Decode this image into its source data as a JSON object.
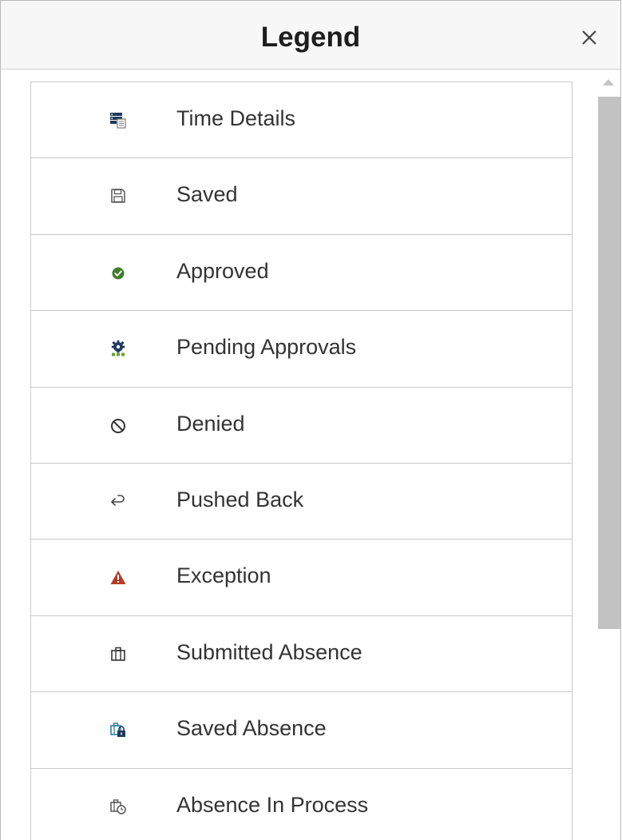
{
  "dialog": {
    "title": "Legend",
    "close_label": "×"
  },
  "items": [
    {
      "label": "Time Details",
      "icon": "time-details-icon"
    },
    {
      "label": "Saved",
      "icon": "save-icon"
    },
    {
      "label": "Approved",
      "icon": "check-circle-icon"
    },
    {
      "label": "Pending Approvals",
      "icon": "gear-icon"
    },
    {
      "label": "Denied",
      "icon": "no-entry-icon"
    },
    {
      "label": "Pushed Back",
      "icon": "undo-arrow-icon"
    },
    {
      "label": "Exception",
      "icon": "warning-triangle-icon"
    },
    {
      "label": "Submitted Absence",
      "icon": "briefcase-icon"
    },
    {
      "label": "Saved Absence",
      "icon": "briefcase-lock-icon"
    },
    {
      "label": "Absence In Process",
      "icon": "briefcase-clock-icon"
    }
  ],
  "colors": {
    "approved_green": "#3e7d2e",
    "exception_red": "#b83a23",
    "pending_navy": "#1f3a5a",
    "saved_absence_teal": "#1b7ba5",
    "icon_gray": "#555555"
  }
}
